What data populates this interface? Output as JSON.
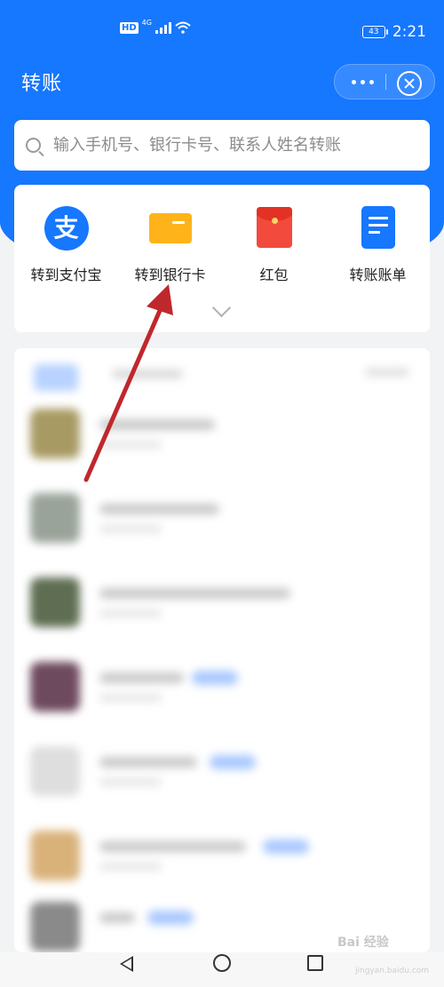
{
  "status_bar": {
    "hd": "HD",
    "network": "4G",
    "battery": "43",
    "time": "2:21"
  },
  "header": {
    "title": "转账",
    "more_icon": "more-dots-icon",
    "close_icon": "close-circle-icon"
  },
  "search": {
    "placeholder": "输入手机号、银行卡号、联系人姓名转账",
    "value": ""
  },
  "quick_actions": [
    {
      "label": "转到支付宝",
      "icon": "alipay-icon",
      "glyph": "支",
      "color": "#1677ff"
    },
    {
      "label": "转到银行卡",
      "icon": "bank-card-icon",
      "color": "#ffb31a"
    },
    {
      "label": "红包",
      "icon": "red-packet-icon",
      "color": "#f24a3c"
    },
    {
      "label": "转账账单",
      "icon": "bill-icon",
      "color": "#1677ff"
    }
  ],
  "colors": {
    "primary": "#1677ff",
    "background": "#f2f3f5",
    "annotation_arrow": "#c0272d"
  },
  "watermark": {
    "text": "Bai 经验",
    "sub": "jingyan.baidu.com"
  }
}
